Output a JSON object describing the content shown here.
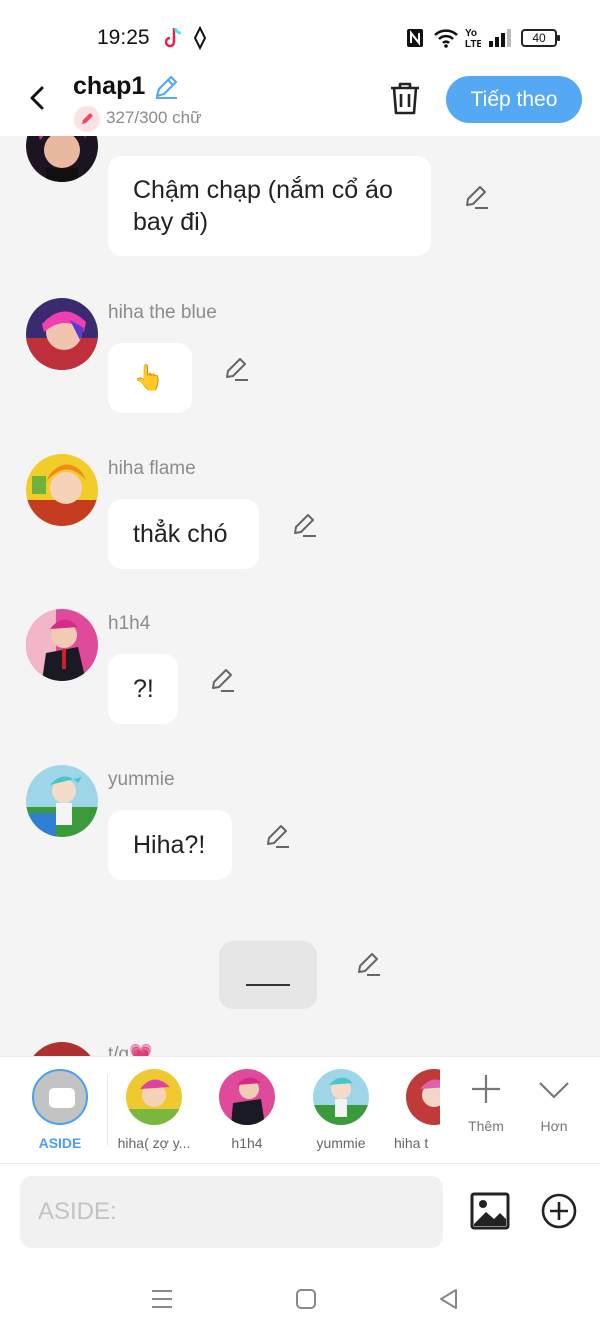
{
  "status": {
    "time": "19:25",
    "battery": "40"
  },
  "header": {
    "title": "chap1",
    "word_count": "327/300 chữ",
    "next_label": "Tiếp theo"
  },
  "messages": [
    {
      "name": "",
      "text": "Chậm chạp (nắm cổ áo bay đi)"
    },
    {
      "name": "hiha the blue",
      "text": "👆"
    },
    {
      "name": "hiha flame",
      "text": "thẳk chó"
    },
    {
      "name": "h1h4",
      "text": "?!"
    },
    {
      "name": "yummie",
      "text": "Hiha?!"
    },
    {
      "name": "t/g💗",
      "text": ""
    }
  ],
  "characters": [
    {
      "label": "ASIDE"
    },
    {
      "label": "hiha( zợ y..."
    },
    {
      "label": "h1h4"
    },
    {
      "label": "yummie"
    },
    {
      "label": "hiha t"
    }
  ],
  "more": {
    "add_label": "Thêm",
    "expand_label": "Hơn"
  },
  "input": {
    "placeholder": "ASIDE:"
  },
  "colors": {
    "accent": "#54a8f4",
    "aside_accent": "#4a9ff0"
  }
}
